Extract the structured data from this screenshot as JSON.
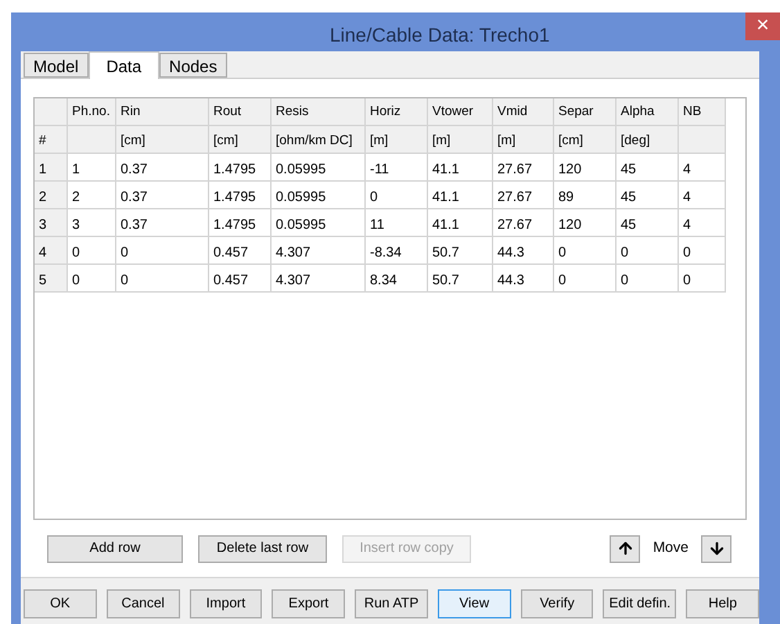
{
  "window": {
    "title": "Line/Cable Data: Trecho1",
    "close": "×"
  },
  "tabs": [
    {
      "label": "Model",
      "selected": false
    },
    {
      "label": "Data",
      "selected": true
    },
    {
      "label": "Nodes",
      "selected": false
    }
  ],
  "table": {
    "columns": [
      {
        "unit": "#"
      },
      {
        "name": "Ph.no."
      },
      {
        "name": "Rin",
        "unit": "[cm]"
      },
      {
        "name": "Rout",
        "unit": "[cm]"
      },
      {
        "name": "Resis",
        "unit": "[ohm/km DC]"
      },
      {
        "name": "Horiz",
        "unit": "[m]"
      },
      {
        "name": "Vtower",
        "unit": "[m]"
      },
      {
        "name": "Vmid",
        "unit": "[m]"
      },
      {
        "name": "Separ",
        "unit": "[cm]"
      },
      {
        "name": "Alpha",
        "unit": "[deg]"
      },
      {
        "name": "NB"
      }
    ],
    "rows": [
      [
        "1",
        "1",
        "0.37",
        "1.4795",
        "0.05995",
        "-11",
        "41.1",
        "27.67",
        "120",
        "45",
        "4"
      ],
      [
        "2",
        "2",
        "0.37",
        "1.4795",
        "0.05995",
        "0",
        "41.1",
        "27.67",
        "89",
        "45",
        "4"
      ],
      [
        "3",
        "3",
        "0.37",
        "1.4795",
        "0.05995",
        "11",
        "41.1",
        "27.67",
        "120",
        "45",
        "4"
      ],
      [
        "4",
        "0",
        "0",
        "0.457",
        "4.307",
        "-8.34",
        "50.7",
        "44.3",
        "0",
        "0",
        "0"
      ],
      [
        "5",
        "0",
        "0",
        "0.457",
        "4.307",
        "8.34",
        "50.7",
        "44.3",
        "0",
        "0",
        "0"
      ]
    ]
  },
  "row_buttons": [
    {
      "label": "Add row",
      "disabled": false
    },
    {
      "label": "Delete last row",
      "disabled": false
    },
    {
      "label": "Insert row copy",
      "disabled": true
    }
  ],
  "move": {
    "label": "Move"
  },
  "buttons": [
    {
      "label": "OK",
      "selected": false
    },
    {
      "label": "Cancel",
      "selected": false
    },
    {
      "label": "Import",
      "selected": false
    },
    {
      "label": "Export",
      "selected": false
    },
    {
      "label": "Run ATP",
      "selected": false
    },
    {
      "label": "View",
      "selected": true
    },
    {
      "label": "Verify",
      "selected": false
    },
    {
      "label": "Edit defin.",
      "selected": false
    },
    {
      "label": "Help",
      "selected": false
    }
  ]
}
